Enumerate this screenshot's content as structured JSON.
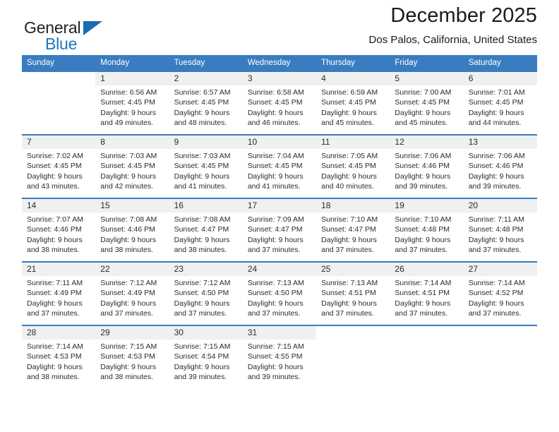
{
  "brand": {
    "name_part1": "General",
    "name_part2": "Blue",
    "logo_icon": "blue-triangle-flag-icon",
    "color_primary": "#1b76bc",
    "color_text": "#231f20"
  },
  "header": {
    "title": "December 2025",
    "location": "Dos Palos, California, United States"
  },
  "theme": {
    "header_bg": "#3a7cc0",
    "header_text": "#ffffff",
    "daynum_bg": "#f0f0f0",
    "body_text": "#2b2b2b"
  },
  "weekdays": [
    "Sunday",
    "Monday",
    "Tuesday",
    "Wednesday",
    "Thursday",
    "Friday",
    "Saturday"
  ],
  "weeks": [
    [
      {
        "day": "",
        "sunrise": "",
        "sunset": "",
        "daylight_line1": "",
        "daylight_line2": ""
      },
      {
        "day": "1",
        "sunrise": "Sunrise: 6:56 AM",
        "sunset": "Sunset: 4:45 PM",
        "daylight_line1": "Daylight: 9 hours",
        "daylight_line2": "and 49 minutes."
      },
      {
        "day": "2",
        "sunrise": "Sunrise: 6:57 AM",
        "sunset": "Sunset: 4:45 PM",
        "daylight_line1": "Daylight: 9 hours",
        "daylight_line2": "and 48 minutes."
      },
      {
        "day": "3",
        "sunrise": "Sunrise: 6:58 AM",
        "sunset": "Sunset: 4:45 PM",
        "daylight_line1": "Daylight: 9 hours",
        "daylight_line2": "and 46 minutes."
      },
      {
        "day": "4",
        "sunrise": "Sunrise: 6:59 AM",
        "sunset": "Sunset: 4:45 PM",
        "daylight_line1": "Daylight: 9 hours",
        "daylight_line2": "and 45 minutes."
      },
      {
        "day": "5",
        "sunrise": "Sunrise: 7:00 AM",
        "sunset": "Sunset: 4:45 PM",
        "daylight_line1": "Daylight: 9 hours",
        "daylight_line2": "and 45 minutes."
      },
      {
        "day": "6",
        "sunrise": "Sunrise: 7:01 AM",
        "sunset": "Sunset: 4:45 PM",
        "daylight_line1": "Daylight: 9 hours",
        "daylight_line2": "and 44 minutes."
      }
    ],
    [
      {
        "day": "7",
        "sunrise": "Sunrise: 7:02 AM",
        "sunset": "Sunset: 4:45 PM",
        "daylight_line1": "Daylight: 9 hours",
        "daylight_line2": "and 43 minutes."
      },
      {
        "day": "8",
        "sunrise": "Sunrise: 7:03 AM",
        "sunset": "Sunset: 4:45 PM",
        "daylight_line1": "Daylight: 9 hours",
        "daylight_line2": "and 42 minutes."
      },
      {
        "day": "9",
        "sunrise": "Sunrise: 7:03 AM",
        "sunset": "Sunset: 4:45 PM",
        "daylight_line1": "Daylight: 9 hours",
        "daylight_line2": "and 41 minutes."
      },
      {
        "day": "10",
        "sunrise": "Sunrise: 7:04 AM",
        "sunset": "Sunset: 4:45 PM",
        "daylight_line1": "Daylight: 9 hours",
        "daylight_line2": "and 41 minutes."
      },
      {
        "day": "11",
        "sunrise": "Sunrise: 7:05 AM",
        "sunset": "Sunset: 4:45 PM",
        "daylight_line1": "Daylight: 9 hours",
        "daylight_line2": "and 40 minutes."
      },
      {
        "day": "12",
        "sunrise": "Sunrise: 7:06 AM",
        "sunset": "Sunset: 4:46 PM",
        "daylight_line1": "Daylight: 9 hours",
        "daylight_line2": "and 39 minutes."
      },
      {
        "day": "13",
        "sunrise": "Sunrise: 7:06 AM",
        "sunset": "Sunset: 4:46 PM",
        "daylight_line1": "Daylight: 9 hours",
        "daylight_line2": "and 39 minutes."
      }
    ],
    [
      {
        "day": "14",
        "sunrise": "Sunrise: 7:07 AM",
        "sunset": "Sunset: 4:46 PM",
        "daylight_line1": "Daylight: 9 hours",
        "daylight_line2": "and 38 minutes."
      },
      {
        "day": "15",
        "sunrise": "Sunrise: 7:08 AM",
        "sunset": "Sunset: 4:46 PM",
        "daylight_line1": "Daylight: 9 hours",
        "daylight_line2": "and 38 minutes."
      },
      {
        "day": "16",
        "sunrise": "Sunrise: 7:08 AM",
        "sunset": "Sunset: 4:47 PM",
        "daylight_line1": "Daylight: 9 hours",
        "daylight_line2": "and 38 minutes."
      },
      {
        "day": "17",
        "sunrise": "Sunrise: 7:09 AM",
        "sunset": "Sunset: 4:47 PM",
        "daylight_line1": "Daylight: 9 hours",
        "daylight_line2": "and 37 minutes."
      },
      {
        "day": "18",
        "sunrise": "Sunrise: 7:10 AM",
        "sunset": "Sunset: 4:47 PM",
        "daylight_line1": "Daylight: 9 hours",
        "daylight_line2": "and 37 minutes."
      },
      {
        "day": "19",
        "sunrise": "Sunrise: 7:10 AM",
        "sunset": "Sunset: 4:48 PM",
        "daylight_line1": "Daylight: 9 hours",
        "daylight_line2": "and 37 minutes."
      },
      {
        "day": "20",
        "sunrise": "Sunrise: 7:11 AM",
        "sunset": "Sunset: 4:48 PM",
        "daylight_line1": "Daylight: 9 hours",
        "daylight_line2": "and 37 minutes."
      }
    ],
    [
      {
        "day": "21",
        "sunrise": "Sunrise: 7:11 AM",
        "sunset": "Sunset: 4:49 PM",
        "daylight_line1": "Daylight: 9 hours",
        "daylight_line2": "and 37 minutes."
      },
      {
        "day": "22",
        "sunrise": "Sunrise: 7:12 AM",
        "sunset": "Sunset: 4:49 PM",
        "daylight_line1": "Daylight: 9 hours",
        "daylight_line2": "and 37 minutes."
      },
      {
        "day": "23",
        "sunrise": "Sunrise: 7:12 AM",
        "sunset": "Sunset: 4:50 PM",
        "daylight_line1": "Daylight: 9 hours",
        "daylight_line2": "and 37 minutes."
      },
      {
        "day": "24",
        "sunrise": "Sunrise: 7:13 AM",
        "sunset": "Sunset: 4:50 PM",
        "daylight_line1": "Daylight: 9 hours",
        "daylight_line2": "and 37 minutes."
      },
      {
        "day": "25",
        "sunrise": "Sunrise: 7:13 AM",
        "sunset": "Sunset: 4:51 PM",
        "daylight_line1": "Daylight: 9 hours",
        "daylight_line2": "and 37 minutes."
      },
      {
        "day": "26",
        "sunrise": "Sunrise: 7:14 AM",
        "sunset": "Sunset: 4:51 PM",
        "daylight_line1": "Daylight: 9 hours",
        "daylight_line2": "and 37 minutes."
      },
      {
        "day": "27",
        "sunrise": "Sunrise: 7:14 AM",
        "sunset": "Sunset: 4:52 PM",
        "daylight_line1": "Daylight: 9 hours",
        "daylight_line2": "and 37 minutes."
      }
    ],
    [
      {
        "day": "28",
        "sunrise": "Sunrise: 7:14 AM",
        "sunset": "Sunset: 4:53 PM",
        "daylight_line1": "Daylight: 9 hours",
        "daylight_line2": "and 38 minutes."
      },
      {
        "day": "29",
        "sunrise": "Sunrise: 7:15 AM",
        "sunset": "Sunset: 4:53 PM",
        "daylight_line1": "Daylight: 9 hours",
        "daylight_line2": "and 38 minutes."
      },
      {
        "day": "30",
        "sunrise": "Sunrise: 7:15 AM",
        "sunset": "Sunset: 4:54 PM",
        "daylight_line1": "Daylight: 9 hours",
        "daylight_line2": "and 39 minutes."
      },
      {
        "day": "31",
        "sunrise": "Sunrise: 7:15 AM",
        "sunset": "Sunset: 4:55 PM",
        "daylight_line1": "Daylight: 9 hours",
        "daylight_line2": "and 39 minutes."
      },
      {
        "day": "",
        "sunrise": "",
        "sunset": "",
        "daylight_line1": "",
        "daylight_line2": ""
      },
      {
        "day": "",
        "sunrise": "",
        "sunset": "",
        "daylight_line1": "",
        "daylight_line2": ""
      },
      {
        "day": "",
        "sunrise": "",
        "sunset": "",
        "daylight_line1": "",
        "daylight_line2": ""
      }
    ]
  ]
}
